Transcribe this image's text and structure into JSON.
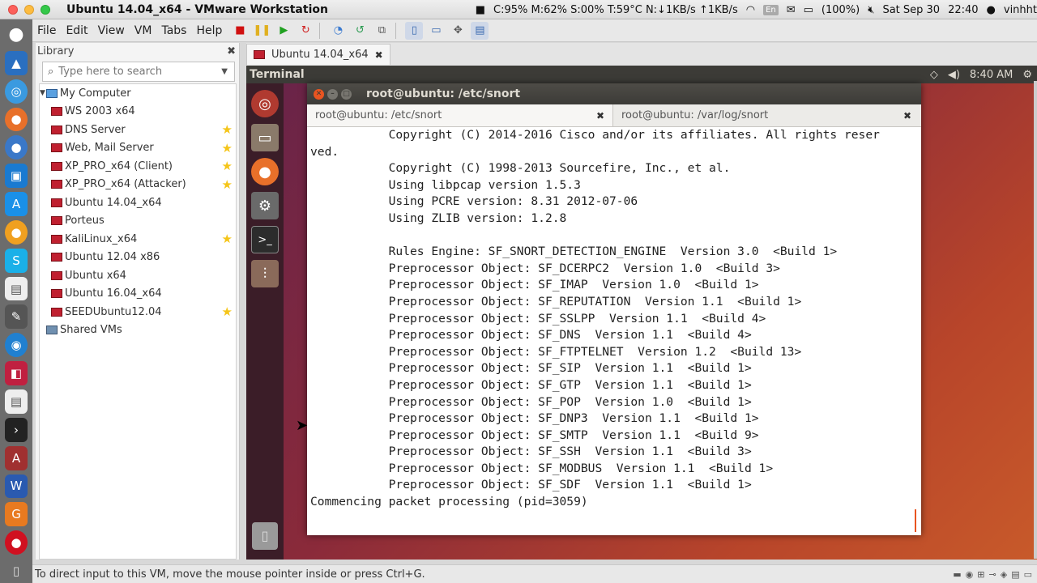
{
  "menubar": {
    "window_title": "Ubuntu 14.04_x64 - VMware Workstation",
    "stats": "C:95% M:62% S:00% T:59°C N:↓1KB/s ↑1KB/s",
    "lang": "En",
    "battery": "(100%)",
    "date": "Sat Sep 30",
    "time": "22:40",
    "user": "vinhht"
  },
  "vmware_menu": {
    "items": [
      "File",
      "Edit",
      "View",
      "VM",
      "Tabs",
      "Help"
    ]
  },
  "library": {
    "title": "Library",
    "search_placeholder": "Type here to search",
    "root": "My Computer",
    "items": [
      {
        "label": "WS 2003 x64",
        "starred": false
      },
      {
        "label": "DNS Server",
        "starred": true
      },
      {
        "label": "Web, Mail Server",
        "starred": true
      },
      {
        "label": "XP_PRO_x64 (Client)",
        "starred": true
      },
      {
        "label": "XP_PRO_x64 (Attacker)",
        "starred": true
      },
      {
        "label": "Ubuntu 14.04_x64",
        "starred": false
      },
      {
        "label": "Porteus",
        "starred": false
      },
      {
        "label": "KaliLinux_x64",
        "starred": true
      },
      {
        "label": "Ubuntu 12.04 x86",
        "starred": false
      },
      {
        "label": "Ubuntu x64",
        "starred": false
      },
      {
        "label": "Ubuntu 16.04_x64",
        "starred": false
      },
      {
        "label": "SEEDUbuntu12.04",
        "starred": true
      }
    ],
    "shared": "Shared VMs"
  },
  "vm_tab": {
    "label": "Ubuntu 14.04_x64",
    "close": "✖"
  },
  "guest": {
    "app_name": "Terminal",
    "time": "8:40 AM",
    "window_title": "root@ubuntu: /etc/snort",
    "tabs": [
      {
        "label": "root@ubuntu: /etc/snort"
      },
      {
        "label": "root@ubuntu: /var/log/snort"
      }
    ],
    "terminal_lines": [
      "           Copyright (C) 2014-2016 Cisco and/or its affiliates. All rights reser",
      "ved.",
      "           Copyright (C) 1998-2013 Sourcefire, Inc., et al.",
      "           Using libpcap version 1.5.3",
      "           Using PCRE version: 8.31 2012-07-06",
      "           Using ZLIB version: 1.2.8",
      "",
      "           Rules Engine: SF_SNORT_DETECTION_ENGINE  Version 3.0  <Build 1>",
      "           Preprocessor Object: SF_DCERPC2  Version 1.0  <Build 3>",
      "           Preprocessor Object: SF_IMAP  Version 1.0  <Build 1>",
      "           Preprocessor Object: SF_REPUTATION  Version 1.1  <Build 1>",
      "           Preprocessor Object: SF_SSLPP  Version 1.1  <Build 4>",
      "           Preprocessor Object: SF_DNS  Version 1.1  <Build 4>",
      "           Preprocessor Object: SF_FTPTELNET  Version 1.2  <Build 13>",
      "           Preprocessor Object: SF_SIP  Version 1.1  <Build 1>",
      "           Preprocessor Object: SF_GTP  Version 1.1  <Build 1>",
      "           Preprocessor Object: SF_POP  Version 1.0  <Build 1>",
      "           Preprocessor Object: SF_DNP3  Version 1.1  <Build 1>",
      "           Preprocessor Object: SF_SMTP  Version 1.1  <Build 9>",
      "           Preprocessor Object: SF_SSH  Version 1.1  <Build 3>",
      "           Preprocessor Object: SF_MODBUS  Version 1.1  <Build 1>",
      "           Preprocessor Object: SF_SDF  Version 1.1  <Build 1>",
      "Commencing packet processing (pid=3059)"
    ]
  },
  "statusbar": {
    "text": "To direct input to this VM, move the mouse pointer inside or press Ctrl+G."
  }
}
